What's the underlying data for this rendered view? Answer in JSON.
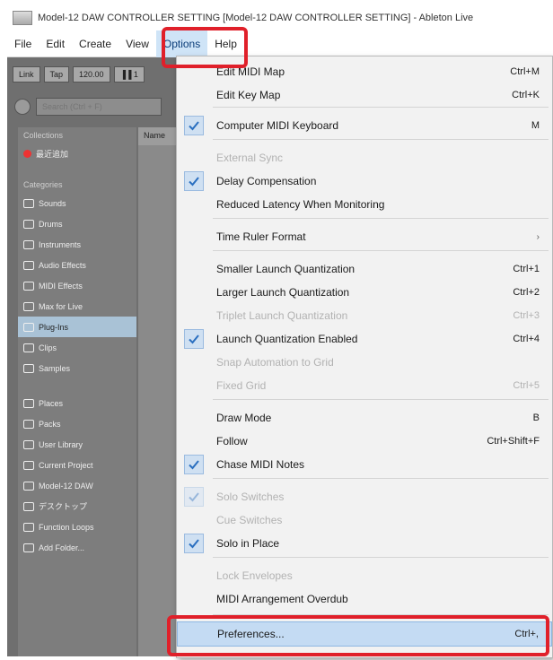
{
  "window": {
    "title": "Model-12 DAW  CONTROLLER SETTING  [Model-12 DAW  CONTROLLER SETTING] - Ableton Live"
  },
  "menubar": {
    "items": [
      "File",
      "Edit",
      "Create",
      "View",
      "Options",
      "Help"
    ],
    "active_index": 4,
    "highlight_color": "#e0202a"
  },
  "toolbar": {
    "buttons": [
      "Link",
      "Tap",
      "120.00",
      "▐▐ 1"
    ]
  },
  "search": {
    "placeholder": "Search (Ctrl + F)"
  },
  "browser": {
    "collections_heading": "Collections",
    "collection_item": "最近追加",
    "categories_heading": "Categories",
    "categories": [
      "Sounds",
      "Drums",
      "Instruments",
      "Audio Effects",
      "MIDI Effects",
      "Max for Live",
      "Plug-Ins",
      "Clips",
      "Samples"
    ],
    "selected_category": "Plug-Ins",
    "places_heading": "Places",
    "places": [
      "Packs",
      "User Library",
      "Current Project",
      "Model-12 DAW",
      "デスクトップ",
      "Function Loops",
      "Add Folder..."
    ],
    "column_header": "Name"
  },
  "options_menu": {
    "items": [
      {
        "label": "Edit MIDI Map",
        "shortcut": "Ctrl+M",
        "checked": false,
        "disabled": false
      },
      {
        "label": "Edit Key Map",
        "shortcut": "Ctrl+K",
        "checked": false,
        "disabled": false
      },
      {
        "label": "Computer MIDI Keyboard",
        "shortcut": "M",
        "checked": true,
        "disabled": false
      },
      {
        "label": "External Sync",
        "shortcut": "",
        "checked": false,
        "disabled": true
      },
      {
        "label": "Delay Compensation",
        "shortcut": "",
        "checked": true,
        "disabled": false
      },
      {
        "label": "Reduced Latency When Monitoring",
        "shortcut": "",
        "checked": false,
        "disabled": false
      },
      {
        "label": "Time Ruler Format",
        "shortcut": "",
        "checked": false,
        "disabled": false,
        "submenu": true
      },
      {
        "label": "Smaller Launch Quantization",
        "shortcut": "Ctrl+1",
        "checked": false,
        "disabled": false
      },
      {
        "label": "Larger Launch Quantization",
        "shortcut": "Ctrl+2",
        "checked": false,
        "disabled": false
      },
      {
        "label": "Triplet Launch Quantization",
        "shortcut": "Ctrl+3",
        "checked": false,
        "disabled": true
      },
      {
        "label": "Launch Quantization Enabled",
        "shortcut": "Ctrl+4",
        "checked": true,
        "disabled": false
      },
      {
        "label": "Snap Automation to Grid",
        "shortcut": "",
        "checked": false,
        "disabled": true
      },
      {
        "label": "Fixed Grid",
        "shortcut": "Ctrl+5",
        "checked": false,
        "disabled": true
      },
      {
        "label": "Draw Mode",
        "shortcut": "B",
        "checked": false,
        "disabled": false
      },
      {
        "label": "Follow",
        "shortcut": "Ctrl+Shift+F",
        "checked": false,
        "disabled": false
      },
      {
        "label": "Chase MIDI Notes",
        "shortcut": "",
        "checked": true,
        "disabled": false
      },
      {
        "label": "Solo Switches",
        "shortcut": "",
        "checked": true,
        "disabled": true
      },
      {
        "label": "Cue Switches",
        "shortcut": "",
        "checked": false,
        "disabled": true
      },
      {
        "label": "Solo in Place",
        "shortcut": "",
        "checked": true,
        "disabled": false
      },
      {
        "label": "Lock Envelopes",
        "shortcut": "",
        "checked": false,
        "disabled": true
      },
      {
        "label": "MIDI Arrangement Overdub",
        "shortcut": "",
        "checked": false,
        "disabled": false
      },
      {
        "label": "Preferences...",
        "shortcut": "Ctrl+,",
        "checked": false,
        "disabled": false,
        "hover": true
      }
    ]
  }
}
